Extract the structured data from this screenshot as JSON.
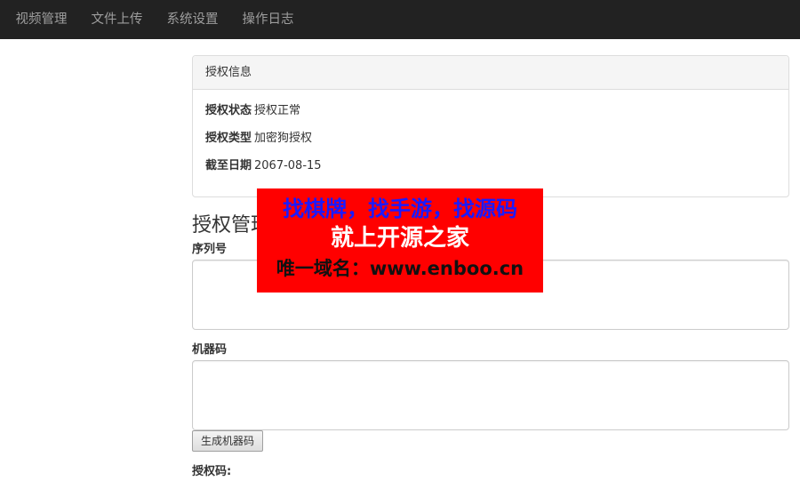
{
  "navbar": {
    "items": [
      "视频管理",
      "文件上传",
      "系统设置",
      "操作日志"
    ]
  },
  "license_panel": {
    "heading": "授权信息",
    "rows": [
      {
        "label": "授权状态",
        "value": "授权正常"
      },
      {
        "label": "授权类型",
        "value": "加密狗授权"
      },
      {
        "label": "截至日期",
        "value": "2067-08-15"
      }
    ]
  },
  "license_manage": {
    "title": "授权管理",
    "serial_label": "序列号",
    "serial_value": "",
    "machine_label": "机器码",
    "machine_value": "",
    "generate_button": "生成机器码",
    "auth_code_label": "授权码:"
  },
  "watermark": {
    "line1": "找棋牌，找手游，找源码",
    "line2": "就上开源之家",
    "line3": "唯一域名：www.enboo.cn"
  },
  "colors": {
    "navbar_bg": "#222222",
    "nav_text": "#9d9d9d",
    "watermark_bg": "#ff0000",
    "watermark_line1": "#1a1aff"
  }
}
